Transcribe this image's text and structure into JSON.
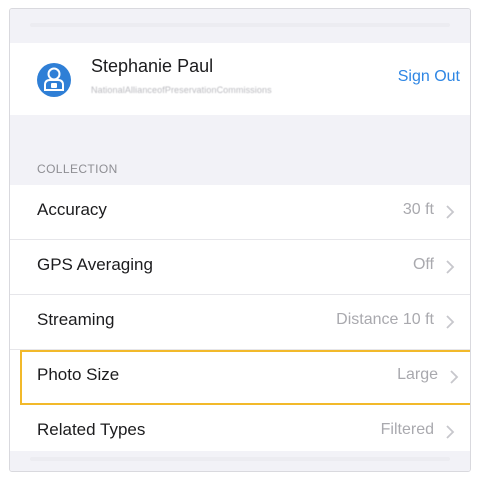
{
  "account": {
    "name": "Stephanie Paul",
    "organization": "NationalAllianceofPreservationCommissions",
    "sign_out_label": "Sign Out",
    "avatar_icon": "person-badge-icon"
  },
  "collection": {
    "header": "COLLECTION",
    "rows": [
      {
        "label": "Accuracy",
        "value": "30 ft",
        "icon": "chevron-right-icon"
      },
      {
        "label": "GPS Averaging",
        "value": "Off",
        "icon": "chevron-right-icon"
      },
      {
        "label": "Streaming",
        "value": "Distance 10 ft",
        "icon": "chevron-right-icon"
      },
      {
        "label": "Photo Size",
        "value": "Large",
        "icon": "chevron-right-icon"
      },
      {
        "label": "Related Types",
        "value": "Filtered",
        "icon": "chevron-right-icon"
      }
    ]
  },
  "colors": {
    "accent": "#2e86e4",
    "highlight": "#f2b92a",
    "avatar": "#2f7fd6"
  }
}
